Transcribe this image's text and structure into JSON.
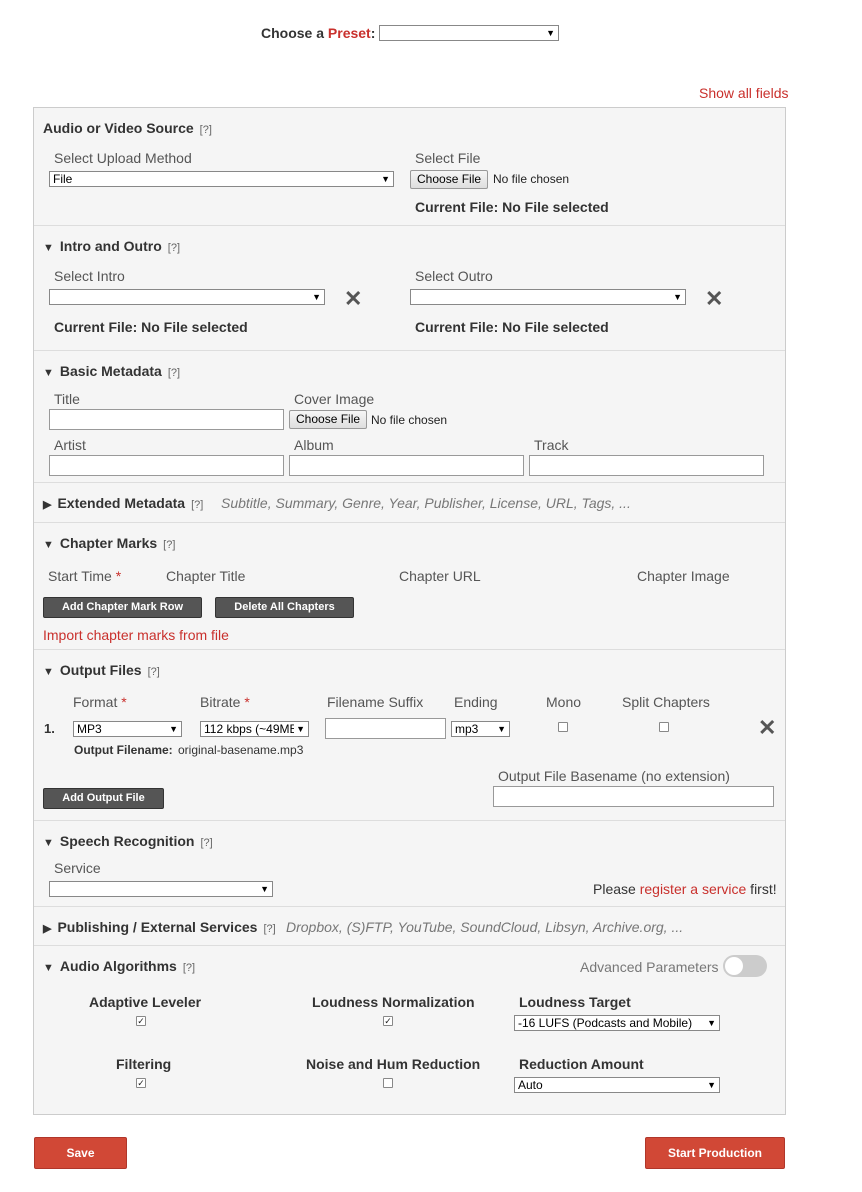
{
  "preset": {
    "label_prefix": "Choose a ",
    "label_link": "Preset",
    "label_suffix": ":",
    "value": ""
  },
  "show_all_fields": "Show all fields",
  "source": {
    "title": "Audio or Video Source",
    "help": "[?]",
    "upload_method_label": "Select Upload Method",
    "upload_method_value": "File",
    "select_file_label": "Select File",
    "choose_file": "Choose File",
    "no_file": "No file chosen",
    "current_file": "Current File: No File selected"
  },
  "intro_outro": {
    "title": "Intro and Outro",
    "help": "[?]",
    "intro_label": "Select Intro",
    "outro_label": "Select Outro",
    "intro_current": "Current File: No File selected",
    "outro_current": "Current File: No File selected"
  },
  "basic_metadata": {
    "title": "Basic Metadata",
    "help": "[?]",
    "title_label": "Title",
    "cover_label": "Cover Image",
    "choose_file": "Choose File",
    "no_file": "No file chosen",
    "artist_label": "Artist",
    "album_label": "Album",
    "track_label": "Track"
  },
  "extended_metadata": {
    "title": "Extended Metadata",
    "help": "[?]",
    "hint": "Subtitle, Summary, Genre, Year, Publisher, License, URL, Tags, ..."
  },
  "chapter_marks": {
    "title": "Chapter Marks",
    "help": "[?]",
    "col_start": "Start Time",
    "required": "*",
    "col_title": "Chapter Title",
    "col_url": "Chapter URL",
    "col_image": "Chapter Image",
    "add_btn": "Add Chapter Mark Row",
    "delete_btn": "Delete All Chapters",
    "import_link": "Import chapter marks from file"
  },
  "output_files": {
    "title": "Output Files",
    "help": "[?]",
    "col_format": "Format",
    "col_bitrate": "Bitrate",
    "required": "*",
    "col_suffix": "Filename Suffix",
    "col_ending": "Ending",
    "col_mono": "Mono",
    "col_split": "Split Chapters",
    "row_num": "1.",
    "format_value": "MP3",
    "bitrate_value": "112 kbps (~49MB",
    "ending_value": "mp3",
    "output_filename_label": "Output Filename:",
    "output_filename_value": "original-basename.mp3",
    "add_btn": "Add Output File",
    "basename_label": "Output File Basename (no extension)"
  },
  "speech": {
    "title": "Speech Recognition",
    "help": "[?]",
    "service_label": "Service",
    "please": "Please ",
    "register_link": "register a service",
    "first": " first!"
  },
  "publishing": {
    "title": "Publishing / External Services",
    "help": "[?]",
    "hint": "Dropbox, (S)FTP, YouTube, SoundCloud, Libsyn, Archive.org, ..."
  },
  "algorithms": {
    "title": "Audio Algorithms",
    "help": "[?]",
    "advanced_label": "Advanced Parameters",
    "adaptive_leveler": "Adaptive Leveler",
    "loudness_norm": "Loudness Normalization",
    "loudness_target": "Loudness Target",
    "loudness_target_value": "-16 LUFS (Podcasts and Mobile)",
    "filtering": "Filtering",
    "noise_reduction": "Noise and Hum Reduction",
    "reduction_amount": "Reduction Amount",
    "reduction_amount_value": "Auto"
  },
  "footer": {
    "save": "Save",
    "start": "Start Production"
  },
  "colors": {
    "accent_red": "#c9302c",
    "button_red": "#d14836",
    "dark_button": "#555555"
  }
}
